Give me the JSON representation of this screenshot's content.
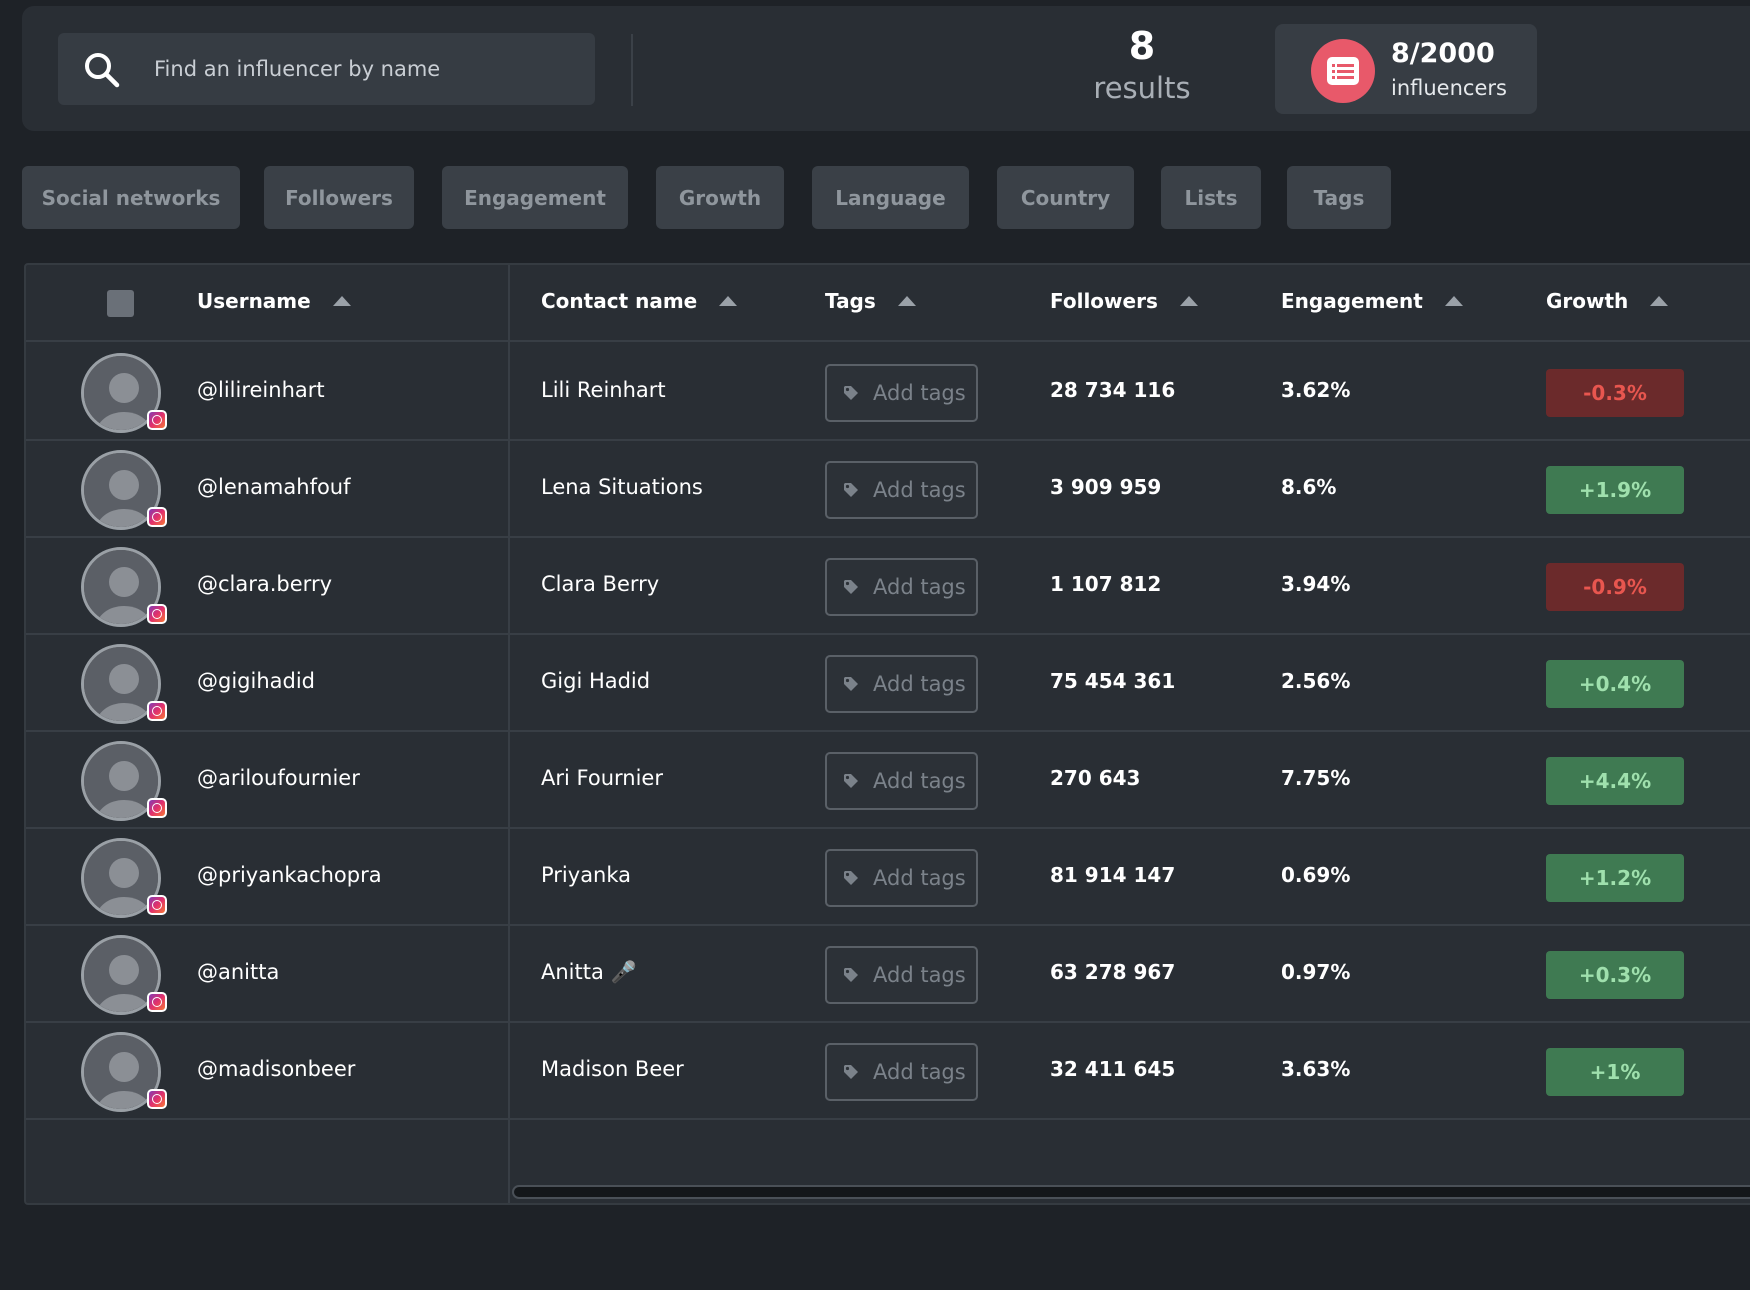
{
  "search": {
    "placeholder": "Find an influencer by name"
  },
  "results": {
    "count": "8",
    "label": "results"
  },
  "quota": {
    "value": "8/2000",
    "label": "influencers"
  },
  "filters": [
    "Social networks",
    "Followers",
    "Engagement",
    "Growth",
    "Language",
    "Country",
    "Lists",
    "Tags"
  ],
  "table": {
    "headers": {
      "username": "Username",
      "contact": "Contact name",
      "tags": "Tags",
      "followers": "Followers",
      "engagement": "Engagement",
      "growth": "Growth"
    },
    "add_tags_label": "Add tags",
    "rows": [
      {
        "username": "@lilireinhart",
        "contact": "Lili Reinhart",
        "followers": "28 734 116",
        "engagement": "3.62%",
        "growth": "-0.3%",
        "growth_sign": "neg"
      },
      {
        "username": "@lenamahfouf",
        "contact": "Lena Situations",
        "followers": "3 909 959",
        "engagement": "8.6%",
        "growth": "+1.9%",
        "growth_sign": "pos"
      },
      {
        "username": "@clara.berry",
        "contact": "Clara Berry",
        "followers": "1 107 812",
        "engagement": "3.94%",
        "growth": "-0.9%",
        "growth_sign": "neg"
      },
      {
        "username": "@gigihadid",
        "contact": "Gigi Hadid",
        "followers": "75 454 361",
        "engagement": "2.56%",
        "growth": "+0.4%",
        "growth_sign": "pos"
      },
      {
        "username": "@ariloufournier",
        "contact": "Ari Fournier",
        "followers": "270 643",
        "engagement": "7.75%",
        "growth": "+4.4%",
        "growth_sign": "pos"
      },
      {
        "username": "@priyankachopra",
        "contact": "Priyanka",
        "followers": "81 914 147",
        "engagement": "0.69%",
        "growth": "+1.2%",
        "growth_sign": "pos"
      },
      {
        "username": "@anitta",
        "contact": "Anitta 🎤",
        "followers": "63 278 967",
        "engagement": "0.97%",
        "growth": "+0.3%",
        "growth_sign": "pos"
      },
      {
        "username": "@madisonbeer",
        "contact": "Madison Beer",
        "followers": "32 411 645",
        "engagement": "3.63%",
        "growth": "+1%",
        "growth_sign": "pos"
      }
    ]
  },
  "colors": {
    "growth_negative_bg": "#6b2a2b",
    "growth_negative_text": "#e8564f",
    "growth_positive_bg": "#3f7a52",
    "growth_positive_text": "#9fe0ad",
    "quota_badge": "#e8596a"
  },
  "icons": {
    "search": "search-icon",
    "quota": "list-icon",
    "tag": "tag-icon",
    "sort": "sort-ascending-icon",
    "social_network": "instagram-icon"
  }
}
